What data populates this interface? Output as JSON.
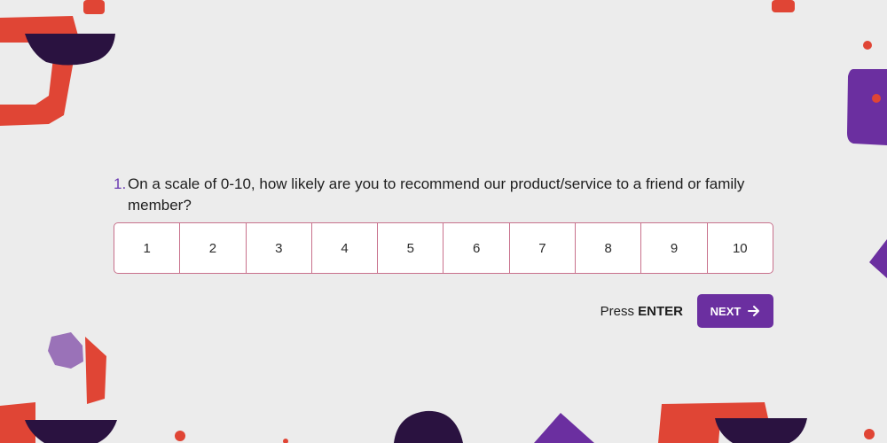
{
  "question": {
    "number": "1.",
    "text": "On a scale of 0-10, how likely are you to recommend our product/service to a friend or family member?"
  },
  "scale": {
    "options": [
      "1",
      "2",
      "3",
      "4",
      "5",
      "6",
      "7",
      "8",
      "9",
      "10"
    ]
  },
  "footer": {
    "press_prefix": "Press",
    "press_key": "ENTER",
    "next_label": "NEXT"
  },
  "colors": {
    "background": "#ececec",
    "accent": "#6b2fa0",
    "border": "#c8718c",
    "decor_red": "#e04535",
    "decor_dark": "#2a1240",
    "decor_lilac": "#9a72b8"
  }
}
